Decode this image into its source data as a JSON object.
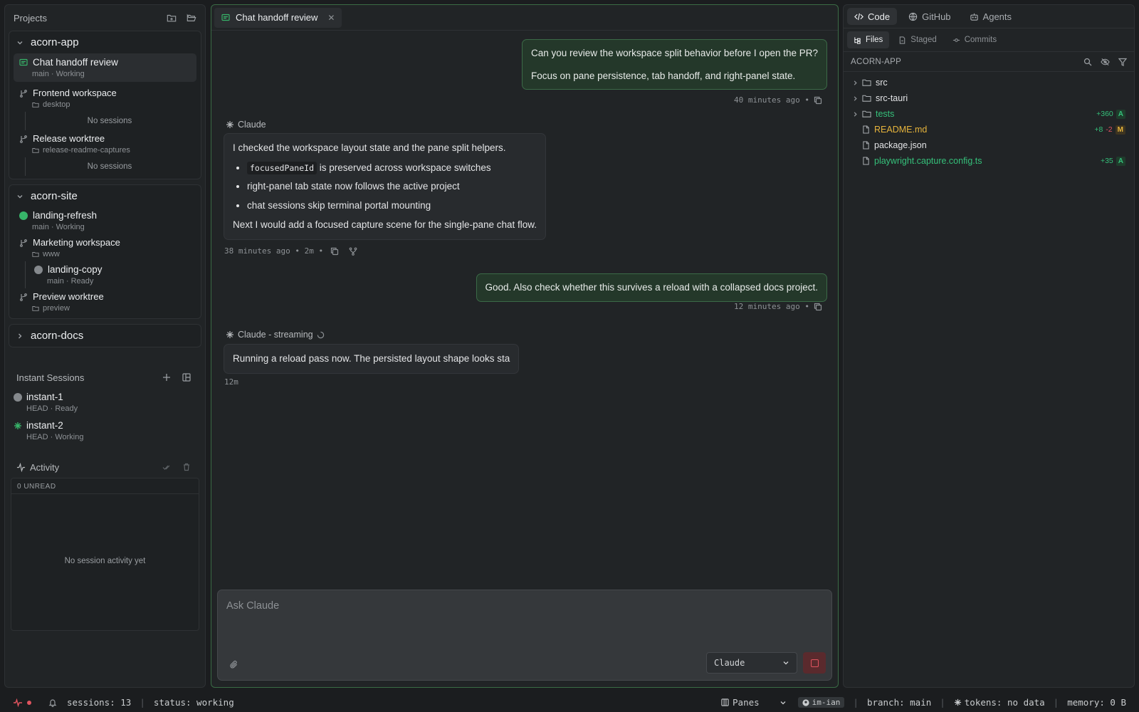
{
  "sidebar": {
    "title": "Projects",
    "projects": [
      {
        "name": "acorn-app",
        "active_session": {
          "title": "Chat handoff review",
          "meta": "main · Working"
        },
        "worktrees": [
          {
            "title": "Frontend workspace",
            "folder": "desktop",
            "empty": "No sessions"
          },
          {
            "title": "Release worktree",
            "folder": "release-readme-captures",
            "empty": "No sessions"
          }
        ]
      },
      {
        "name": "acorn-site",
        "top_session": {
          "title": "landing-refresh",
          "meta": "main · Working"
        },
        "worktrees": [
          {
            "title": "Marketing workspace",
            "folder": "www",
            "session": {
              "title": "landing-copy",
              "meta": "main · Ready"
            }
          },
          {
            "title": "Preview worktree",
            "folder": "preview"
          }
        ]
      },
      {
        "name": "acorn-docs"
      }
    ],
    "instant": {
      "title": "Instant Sessions",
      "items": [
        {
          "title": "instant-1",
          "meta": "HEAD · Ready"
        },
        {
          "title": "instant-2",
          "meta": "HEAD · Working"
        }
      ]
    },
    "activity": {
      "title": "Activity",
      "unread": "0 UNREAD",
      "empty": "No session activity yet"
    }
  },
  "center": {
    "tab": "Chat handoff review",
    "messages": {
      "user1": {
        "lines": [
          "Can you review the workspace split behavior before I open the PR?",
          "Focus on pane persistence, tab handoff, and right-panel state."
        ],
        "meta": "40 minutes ago •"
      },
      "assistant1": {
        "label": "Claude",
        "intro": "I checked the workspace layout state and the pane split helpers.",
        "bullet1_code": "focusedPaneId",
        "bullet1_rest": " is preserved across workspace switches",
        "bullet2": "right-panel tab state now follows the active project",
        "bullet3": "chat sessions skip terminal portal mounting",
        "outro": "Next I would add a focused capture scene for the single-pane chat flow.",
        "meta": "38 minutes ago • 2m •"
      },
      "user2": {
        "text": "Good. Also check whether this survives a reload with a collapsed docs project.",
        "meta": "12 minutes ago •"
      },
      "assistant2": {
        "label": "Claude - streaming",
        "text": "Running a reload pass now. The persisted layout shape looks sta",
        "meta": "12m"
      }
    },
    "composer": {
      "placeholder": "Ask Claude",
      "model": "Claude"
    }
  },
  "right": {
    "tabs": [
      "Code",
      "GitHub",
      "Agents"
    ],
    "subtabs": [
      "Files",
      "Staged",
      "Commits"
    ],
    "repo": "ACORN-APP",
    "files": [
      {
        "name": "src",
        "kind": "folder"
      },
      {
        "name": "src-tauri",
        "kind": "folder"
      },
      {
        "name": "tests",
        "kind": "folder",
        "add": "+360",
        "badge": "A"
      },
      {
        "name": "README.md",
        "kind": "file",
        "add": "+8",
        "del": "-2",
        "badge": "M"
      },
      {
        "name": "package.json",
        "kind": "file"
      },
      {
        "name": "playwright.capture.config.ts",
        "kind": "file",
        "add": "+35",
        "badge": "A"
      }
    ]
  },
  "statusbar": {
    "sessions": "sessions: 13",
    "status": "status: working",
    "panes": "Panes",
    "gh_user": "im-ian",
    "branch": "branch: main",
    "tokens": "tokens: no data",
    "memory": "memory: 0 B"
  },
  "colors": {
    "accent_green": "#37b469",
    "user_bubble": "#24382a",
    "danger": "#e0545f",
    "modified": "#e6b43c"
  }
}
